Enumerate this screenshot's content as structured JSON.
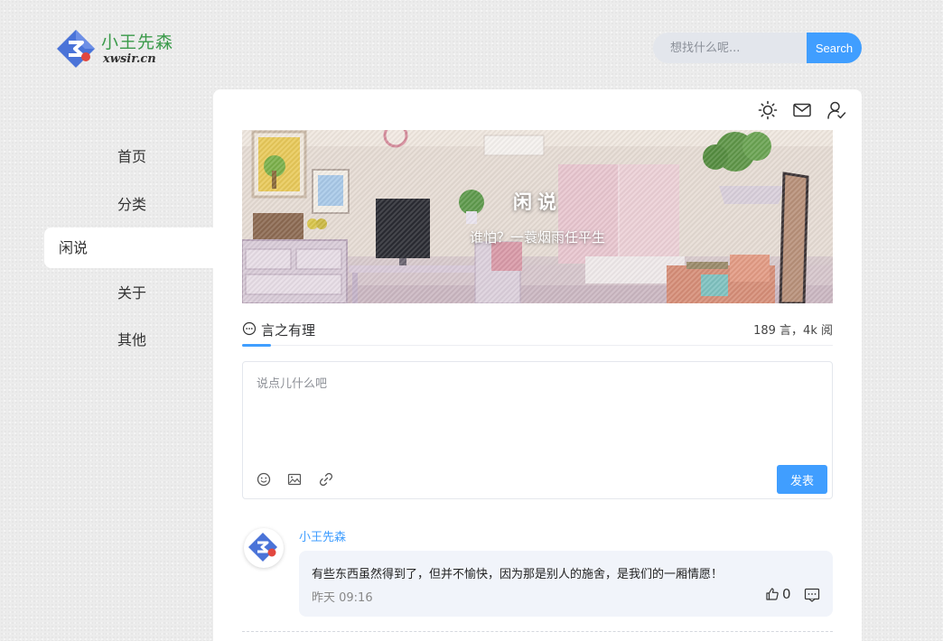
{
  "header": {
    "logo_cn": "小王先森",
    "logo_en": "xwsir.cn",
    "search": {
      "placeholder": "想找什么呢...",
      "button_label": "Search"
    }
  },
  "nav": {
    "items": [
      {
        "label": "首页",
        "active": false
      },
      {
        "label": "分类",
        "active": false
      },
      {
        "label": "闲说",
        "active": true
      },
      {
        "label": "关于",
        "active": false
      },
      {
        "label": "其他",
        "active": false
      }
    ]
  },
  "toolbar": {
    "icons": [
      "sun-icon",
      "mail-icon",
      "user-check-icon"
    ]
  },
  "banner": {
    "title": "闲说",
    "subtitle": "谁怕？一蓑烟雨任平生"
  },
  "section": {
    "title": "言之有理",
    "stats": "189 言，4k 阅"
  },
  "editor": {
    "placeholder": "说点儿什么吧",
    "submit_label": "发表"
  },
  "comments": [
    {
      "author": "小王先森",
      "text": "有些东西虽然得到了，但并不愉快，因为那是别人的施舍，是我们的一厢情愿！",
      "time": "昨天 09:16",
      "likes": "0"
    }
  ],
  "colors": {
    "accent": "#409eff",
    "logo_green": "#3a9a4a"
  }
}
